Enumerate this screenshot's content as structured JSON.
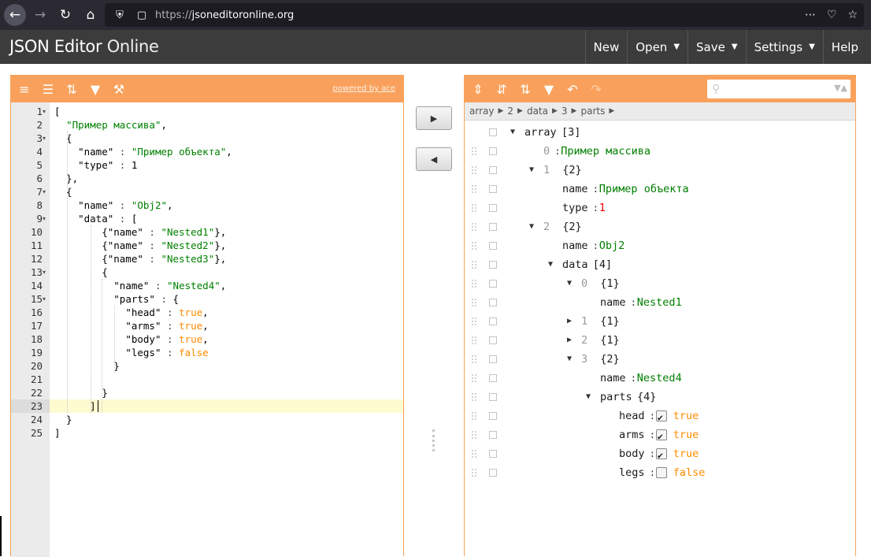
{
  "browser": {
    "url_host": "jsoneditoronline.org",
    "url_scheme": "https://",
    "back_icon": "arrow-left",
    "forward_icon": "arrow-right",
    "reload_icon": "reload",
    "home_icon": "home"
  },
  "app": {
    "logo_bold": "JSON Editor",
    "logo_light": "Online",
    "menu": {
      "new": "New",
      "open": "Open",
      "save": "Save",
      "settings": "Settings",
      "help": "Help"
    }
  },
  "code_panel": {
    "powered_by": "powered by ace",
    "lines": [
      {
        "n": "1",
        "t": "["
      },
      {
        "n": "2",
        "t": "  \"Пример массива\","
      },
      {
        "n": "3",
        "t": "  {"
      },
      {
        "n": "4",
        "t": "    \"name\" : \"Пример объекта\","
      },
      {
        "n": "5",
        "t": "    \"type\" : 1"
      },
      {
        "n": "6",
        "t": "  },"
      },
      {
        "n": "7",
        "t": "  {"
      },
      {
        "n": "8",
        "t": "    \"name\" : \"Obj2\","
      },
      {
        "n": "9",
        "t": "    \"data\" : ["
      },
      {
        "n": "10",
        "t": "        {\"name\" : \"Nested1\"},"
      },
      {
        "n": "11",
        "t": "        {\"name\" : \"Nested2\"},"
      },
      {
        "n": "12",
        "t": "        {\"name\" : \"Nested3\"},"
      },
      {
        "n": "13",
        "t": "        {"
      },
      {
        "n": "14",
        "t": "          \"name\" : \"Nested4\","
      },
      {
        "n": "15",
        "t": "          \"parts\" : {"
      },
      {
        "n": "16",
        "t": "            \"head\" : true,"
      },
      {
        "n": "17",
        "t": "            \"arms\" : true,"
      },
      {
        "n": "18",
        "t": "            \"body\" : true,"
      },
      {
        "n": "19",
        "t": "            \"legs\" : false"
      },
      {
        "n": "20",
        "t": "          }"
      },
      {
        "n": "21",
        "t": ""
      },
      {
        "n": "22",
        "t": "        }"
      },
      {
        "n": "23",
        "t": "      ]"
      },
      {
        "n": "24",
        "t": "  }"
      },
      {
        "n": "25",
        "t": "]"
      }
    ],
    "active_line": "23"
  },
  "tree_panel": {
    "search_placeholder": "",
    "breadcrumb": [
      "array",
      "2",
      "data",
      "3",
      "parts"
    ],
    "rows": [
      {
        "key": "array",
        "value": "[3]",
        "kind": "cnt"
      },
      {
        "key": "0",
        "value": "Пример массива",
        "kind": "str"
      },
      {
        "key": "1",
        "value": "{2}",
        "kind": "cnt"
      },
      {
        "key": "name",
        "value": "Пример объекта",
        "kind": "str"
      },
      {
        "key": "type",
        "value": "1",
        "kind": "num"
      },
      {
        "key": "2",
        "value": "{2}",
        "kind": "cnt"
      },
      {
        "key": "name",
        "value": "Obj2",
        "kind": "str"
      },
      {
        "key": "data",
        "value": "[4]",
        "kind": "cnt"
      },
      {
        "key": "0",
        "value": "{1}",
        "kind": "cnt"
      },
      {
        "key": "name",
        "value": "Nested1",
        "kind": "str"
      },
      {
        "key": "1",
        "value": "{1}",
        "kind": "cnt"
      },
      {
        "key": "2",
        "value": "{1}",
        "kind": "cnt"
      },
      {
        "key": "3",
        "value": "{2}",
        "kind": "cnt"
      },
      {
        "key": "name",
        "value": "Nested4",
        "kind": "str"
      },
      {
        "key": "parts",
        "value": "{4}",
        "kind": "cnt"
      },
      {
        "key": "head",
        "value": "true",
        "kind": "bool",
        "checked": true
      },
      {
        "key": "arms",
        "value": "true",
        "kind": "bool",
        "checked": true
      },
      {
        "key": "body",
        "value": "true",
        "kind": "bool",
        "checked": true
      },
      {
        "key": "legs",
        "value": "false",
        "kind": "bool",
        "checked": false
      }
    ]
  },
  "colors": {
    "toolbar": "#f9a15c",
    "string": "#008000",
    "number": "#ee0000",
    "boolean": "#ff8c00"
  }
}
